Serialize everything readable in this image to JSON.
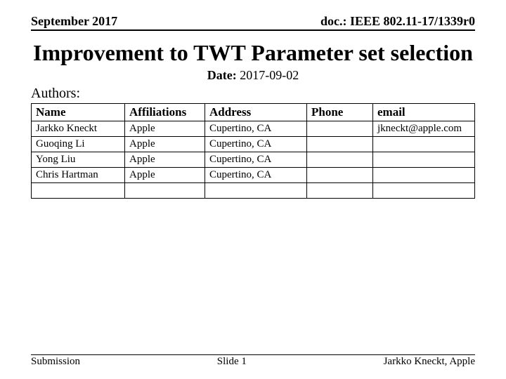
{
  "header": {
    "left": "September 2017",
    "right": "doc.: IEEE 802.11-17/1339r0"
  },
  "title": "Improvement to TWT Parameter set selection",
  "date": {
    "label": "Date:",
    "value": "2017-09-02"
  },
  "authors_label": "Authors:",
  "table": {
    "columns": [
      "Name",
      "Affiliations",
      "Address",
      "Phone",
      "email"
    ],
    "rows": [
      {
        "name": "Jarkko Kneckt",
        "affil": "Apple",
        "addr": "Cupertino, CA",
        "phone": "",
        "email": "jkneckt@apple.com"
      },
      {
        "name": "Guoqing Li",
        "affil": "Apple",
        "addr": "Cupertino, CA",
        "phone": "",
        "email": ""
      },
      {
        "name": "Yong Liu",
        "affil": "Apple",
        "addr": "Cupertino, CA",
        "phone": "",
        "email": ""
      },
      {
        "name": "Chris Hartman",
        "affil": "Apple",
        "addr": "Cupertino, CA",
        "phone": "",
        "email": ""
      },
      {
        "name": "",
        "affil": "",
        "addr": "",
        "phone": "",
        "email": ""
      }
    ]
  },
  "footer": {
    "left": "Submission",
    "center": "Slide 1",
    "right": "Jarkko Kneckt, Apple"
  }
}
